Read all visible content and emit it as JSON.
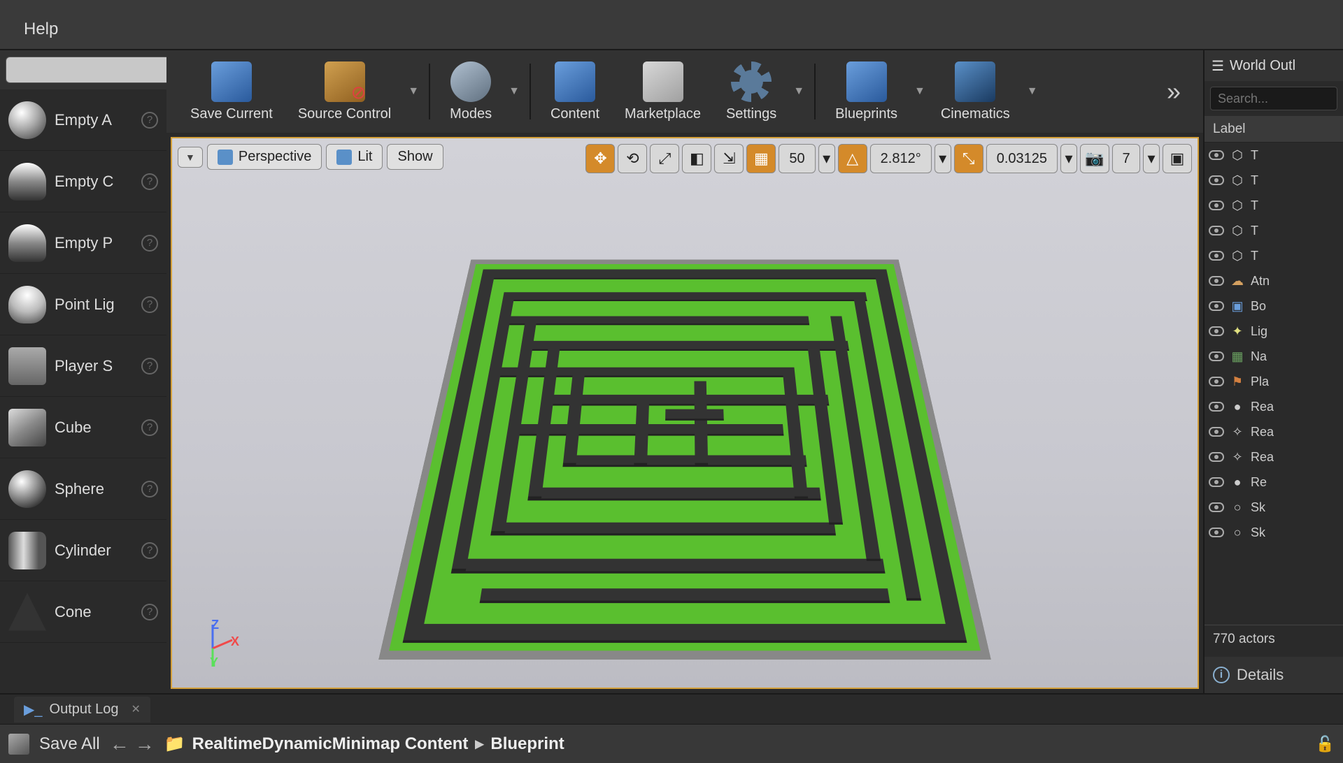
{
  "menubar": {
    "help": "Help"
  },
  "toolbar": {
    "save_current": "Save Current",
    "source_control": "Source Control",
    "modes": "Modes",
    "content": "Content",
    "marketplace": "Marketplace",
    "settings": "Settings",
    "blueprints": "Blueprints",
    "cinematics": "Cinematics"
  },
  "left_panel": {
    "search_placeholder": "",
    "items": [
      {
        "label": "Empty A"
      },
      {
        "label": "Empty C"
      },
      {
        "label": "Empty P"
      },
      {
        "label": "Point Lig"
      },
      {
        "label": "Player S"
      },
      {
        "label": "Cube"
      },
      {
        "label": "Sphere"
      },
      {
        "label": "Cylinder"
      },
      {
        "label": "Cone"
      }
    ]
  },
  "viewport": {
    "view_mode": "Perspective",
    "lit": "Lit",
    "show": "Show",
    "grid_snap": "50",
    "rotation_snap": "2.812°",
    "scale_snap": "0.03125",
    "camera_speed": "7",
    "axes": {
      "z": "Z",
      "x": "X",
      "y": "Y"
    }
  },
  "right_panel": {
    "title": "World Outl",
    "search_placeholder": "Search...",
    "label_header": "Label",
    "items": [
      {
        "label": "T"
      },
      {
        "label": "T"
      },
      {
        "label": "T"
      },
      {
        "label": "T"
      },
      {
        "label": "T"
      },
      {
        "label": "Atn"
      },
      {
        "label": "Bo"
      },
      {
        "label": "Lig"
      },
      {
        "label": "Na"
      },
      {
        "label": "Pla"
      },
      {
        "label": "Rea"
      },
      {
        "label": "Rea"
      },
      {
        "label": "Rea"
      },
      {
        "label": "Re"
      },
      {
        "label": "Sk"
      },
      {
        "label": "Sk"
      }
    ],
    "actor_count": "770 actors",
    "details": "Details"
  },
  "bottom": {
    "tab_output_log": "Output Log",
    "save_all": "Save All",
    "breadcrumb": {
      "root": "RealtimeDynamicMinimap Content",
      "sub": "Blueprint"
    }
  }
}
